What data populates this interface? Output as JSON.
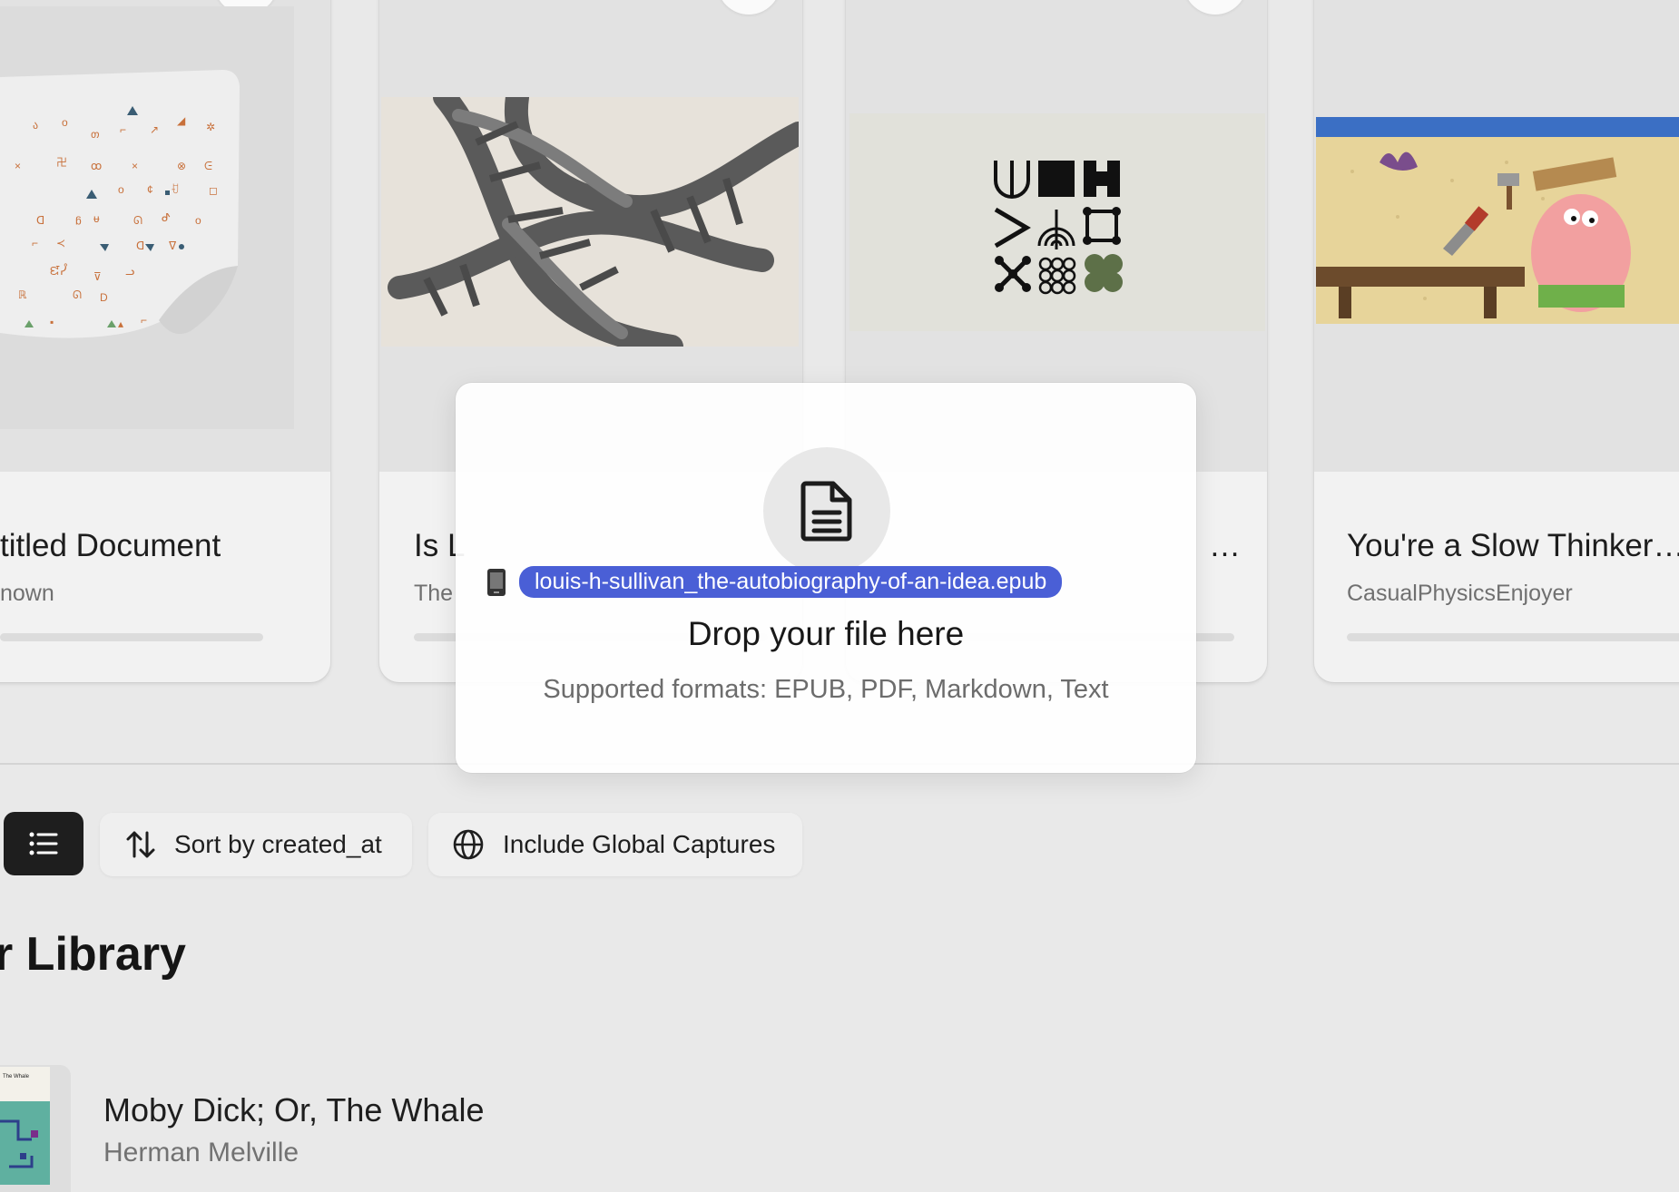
{
  "cards": [
    {
      "title": "titled Document",
      "author": "nown"
    },
    {
      "title": "Is L",
      "author": "The"
    },
    {
      "title": "…",
      "author": ""
    },
    {
      "title": "You're a Slow Thinker…",
      "author": "CasualPhysicsEnjoyer"
    }
  ],
  "drop_overlay": {
    "dragged_file": "louis-h-sullivan_the-autobiography-of-an-idea.epub",
    "title": "Drop your file here",
    "subtitle": "Supported formats: EPUB, PDF, Markdown, Text"
  },
  "toolbar": {
    "sort_label": "Sort by created_at",
    "global_label": "Include Global Captures"
  },
  "library": {
    "title": "r Library",
    "books": [
      {
        "title": "Moby Dick; Or, The Whale",
        "author": "Herman Melville",
        "cover_text": "The Whale"
      }
    ]
  },
  "colors": {
    "accent": "#4a5fd6",
    "dark_button": "#1e1e1e",
    "background": "#e9e9e9"
  },
  "icons": [
    "document-icon",
    "list-icon",
    "sort-arrows-icon",
    "globe-icon",
    "phone-file-icon",
    "more-dots-icon"
  ]
}
